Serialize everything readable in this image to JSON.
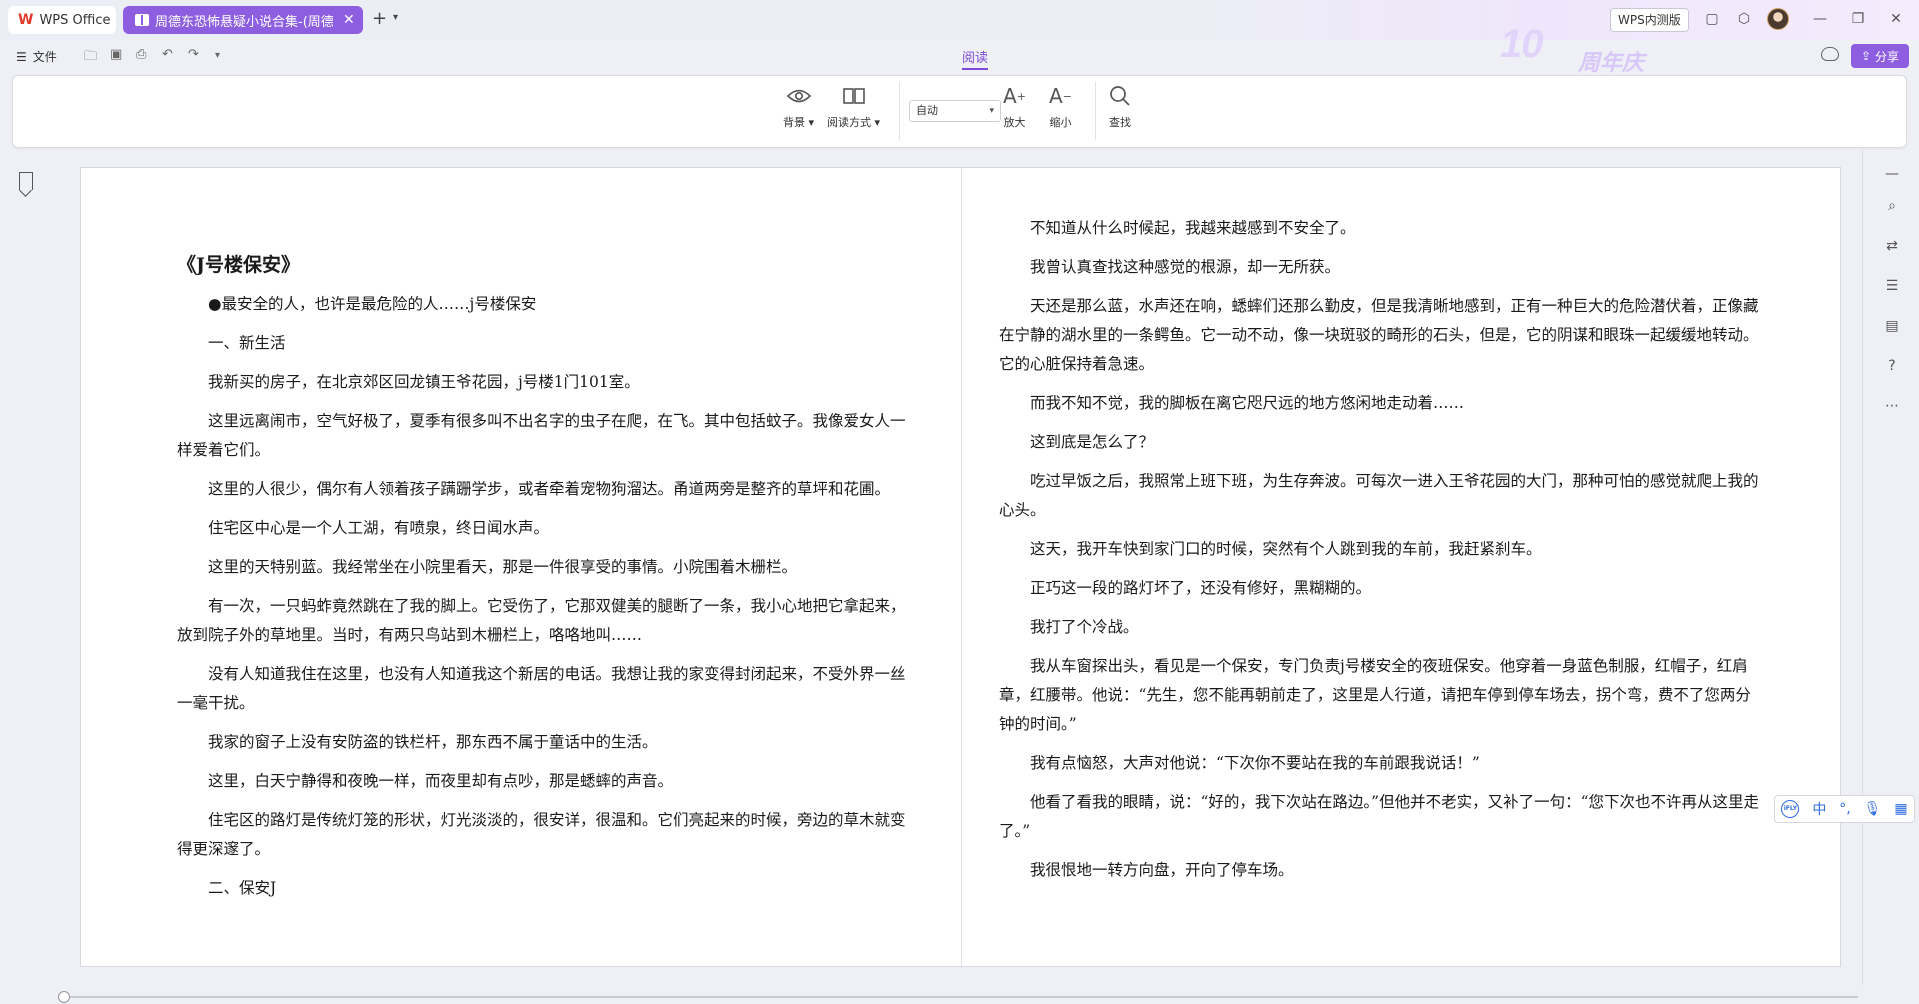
{
  "titlebar": {
    "app_tab": "WPS Office",
    "doc_tab": "周德东恐怖悬疑小说合集-(周德东",
    "beta_badge": "WPS内测版",
    "anniversary_number": "10",
    "anniversary_text": "周年庆"
  },
  "menubar": {
    "file_label": "文件",
    "active_tab": "阅读",
    "share_label": "分享"
  },
  "ribbon": {
    "background_label": "背景",
    "reading_mode_label": "阅读方式",
    "auto_select_value": "自动",
    "zoom_in_label": "放大",
    "zoom_out_label": "缩小",
    "find_label": "查找"
  },
  "document": {
    "title": "《J号楼保安》",
    "left_paragraphs": [
      "●最安全的人，也许是最危险的人……j号楼保安",
      "一、新生活",
      "我新买的房子，在北京郊区回龙镇王爷花园，j号楼1门101室。",
      "这里远离闹市，空气好极了，夏季有很多叫不出名字的虫子在爬，在飞。其中包括蚊子。我像爱女人一样爱着它们。",
      "这里的人很少，偶尔有人领着孩子蹒跚学步，或者牵着宠物狗溜达。甬道两旁是整齐的草坪和花圃。",
      "住宅区中心是一个人工湖，有喷泉，终日闻水声。",
      "这里的天特别蓝。我经常坐在小院里看天，那是一件很享受的事情。小院围着木栅栏。",
      "有一次，一只蚂蚱竟然跳在了我的脚上。它受伤了，它那双健美的腿断了一条，我小心地把它拿起来，放到院子外的草地里。当时，有两只鸟站到木栅栏上，咯咯地叫……",
      "没有人知道我住在这里，也没有人知道我这个新居的电话。我想让我的家变得封闭起来，不受外界一丝一毫干扰。",
      "我家的窗子上没有安防盗的铁栏杆，那东西不属于童话中的生活。",
      "这里，白天宁静得和夜晚一样，而夜里却有点吵，那是蟋蟀的声音。",
      "住宅区的路灯是传统灯笼的形状，灯光淡淡的，很安详，很温和。它们亮起来的时候，旁边的草木就变得更深邃了。",
      "二、保安J"
    ],
    "right_paragraphs": [
      "不知道从什么时候起，我越来越感到不安全了。",
      "我曾认真查找这种感觉的根源，却一无所获。",
      "天还是那么蓝，水声还在响，蟋蟀们还那么勤皮，但是我清晰地感到，正有一种巨大的危险潜伏着，正像藏在宁静的湖水里的一条鳄鱼。它一动不动，像一块斑驳的畸形的石头，但是，它的阴谋和眼珠一起缓缓地转动。它的心脏保持着急速。",
      "而我不知不觉，我的脚板在离它咫尺远的地方悠闲地走动着……",
      "这到底是怎么了？",
      "吃过早饭之后，我照常上班下班，为生存奔波。可每次一进入王爷花园的大门，那种可怕的感觉就爬上我的心头。",
      "这天，我开车快到家门口的时候，突然有个人跳到我的车前，我赶紧刹车。",
      "正巧这一段的路灯坏了，还没有修好，黑糊糊的。",
      "我打了个冷战。",
      "我从车窗探出头，看见是一个保安，专门负责j号楼安全的夜班保安。他穿着一身蓝色制服，红帽子，红肩章，红腰带。他说：“先生，您不能再朝前走了，这里是人行道，请把车停到停车场去，拐个弯，费不了您两分钟的时间。”",
      "我有点恼怒，大声对他说：“下次你不要站在我的车前跟我说话！”",
      "他看了看我的眼睛，说：“好的，我下次站在路边。”但他并不老实，又补了一句：“您下次也不许再从这里走了。”",
      "我很恨地一转方向盘，开向了停车场。"
    ]
  },
  "ime": {
    "logo": "iFLY",
    "lang": "中"
  },
  "colors": {
    "accent": "#8d5fe0",
    "wps_red": "#e23b2e"
  }
}
